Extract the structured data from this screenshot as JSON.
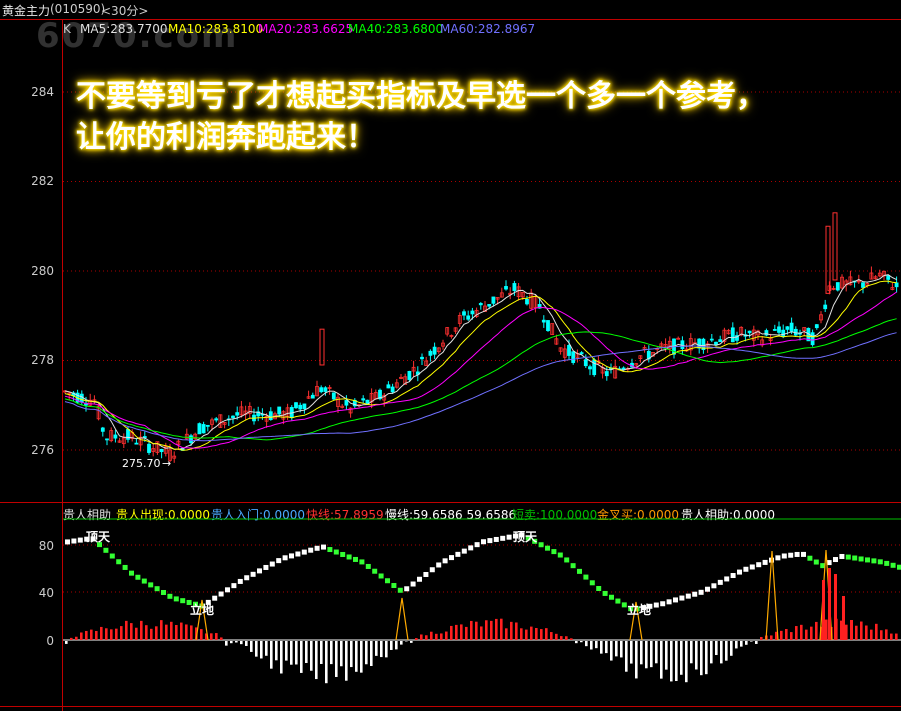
{
  "window": {
    "title": "黄金主力",
    "code": "(010590)",
    "period": "<30分>"
  },
  "watermark": "6070.com",
  "price_panel": {
    "indicator_prefix": "K",
    "ma": [
      {
        "label": "MA5:283.7700",
        "color": "#e0e0e0"
      },
      {
        "label": "MA10:283.8100",
        "color": "#ffff00"
      },
      {
        "label": "MA20:283.6625",
        "color": "#ff00ff"
      },
      {
        "label": "MA40:283.6800",
        "color": "#00ff00"
      },
      {
        "label": "MA60:282.8967",
        "color": "#7070ff"
      }
    ],
    "y_ticks": [
      "284",
      "282",
      "280",
      "278",
      "276"
    ],
    "low_marker": "275.70"
  },
  "ad_text": {
    "line1": "不要等到亏了才想起买指标及早选一个多一个参考，",
    "line2": "让你的利润奔跑起来！"
  },
  "indicator_panel": {
    "items": [
      {
        "label": "贵人相助",
        "color": "#e0e0e0"
      },
      {
        "label": "贵人出现:0.0000",
        "color": "#ffff00"
      },
      {
        "label": "贵人入门:0.0000",
        "color": "#4aa8ff"
      },
      {
        "label": "快线:57.8959",
        "color": "#ff3030"
      },
      {
        "label": "慢线:59.6586 59.6586",
        "color": "#ffffff"
      },
      {
        "label": "短卖:100.0000",
        "color": "#00c000"
      },
      {
        "label": "金叉买:0.0000",
        "color": "#ff9900"
      },
      {
        "label": "贵人相助:0.0000",
        "color": "#ffffff"
      }
    ],
    "y_ticks": [
      "80",
      "40",
      "0"
    ],
    "annotations": [
      "顶天",
      "立地",
      "顶天",
      "立地"
    ]
  },
  "colors": {
    "up": "#ff3030",
    "down": "#00ffff",
    "grid": "#aa0000",
    "axis": "#c00000"
  }
}
